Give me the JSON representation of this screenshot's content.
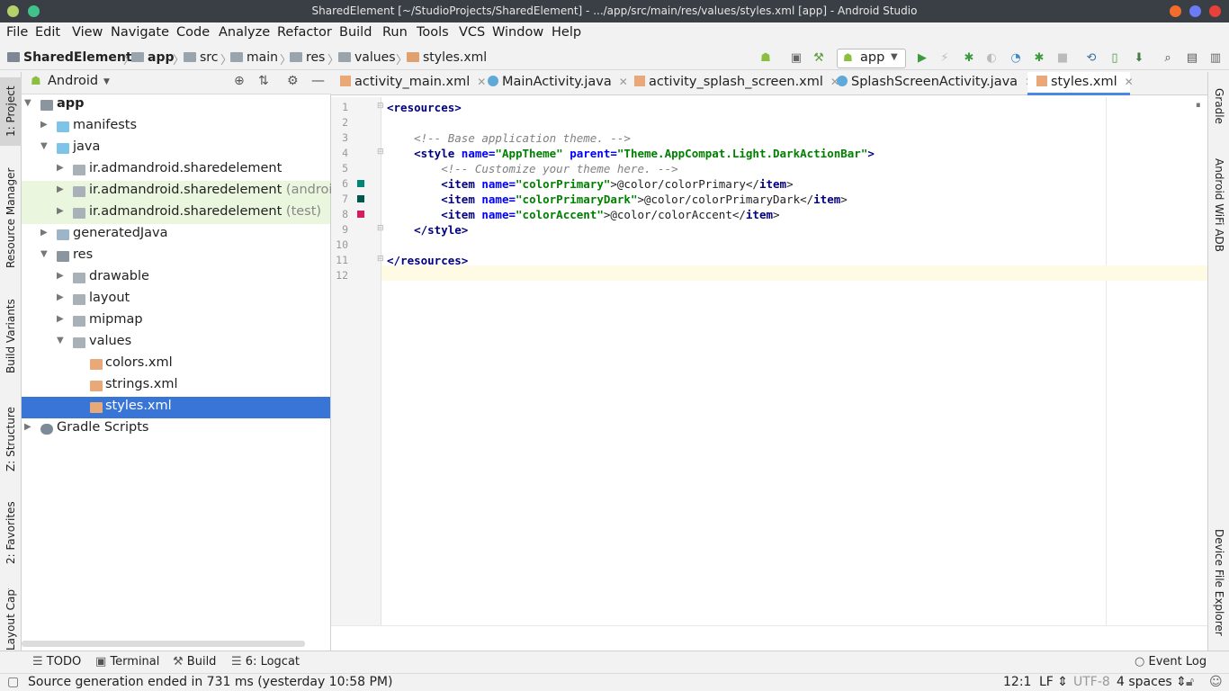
{
  "window": {
    "title": "SharedElement [~/StudioProjects/SharedElement] - .../app/src/main/res/values/styles.xml [app] - Android Studio",
    "controls": [
      "minimize",
      "maximize",
      "close"
    ]
  },
  "menu": [
    "File",
    "Edit",
    "View",
    "Navigate",
    "Code",
    "Analyze",
    "Refactor",
    "Build",
    "Run",
    "Tools",
    "VCS",
    "Window",
    "Help"
  ],
  "breadcrumb": [
    "SharedElement",
    "app",
    "src",
    "main",
    "res",
    "values",
    "styles.xml"
  ],
  "toolbar": {
    "run_config": "app"
  },
  "left_tool_windows": [
    "1: Project",
    "Resource Manager",
    "Build Variants",
    "Z: Structure",
    "2: Favorites",
    "Layout Captures"
  ],
  "right_tool_windows": [
    "Gradle",
    "Android WiFi ADB",
    "Device File Explorer"
  ],
  "project_panel": {
    "view_mode": "Android",
    "tree": [
      {
        "label": "app",
        "bold": true,
        "level": 0
      },
      {
        "label": "manifests",
        "level": 1
      },
      {
        "label": "java",
        "level": 1
      },
      {
        "label": "ir.admandroid.sharedelement",
        "level": 2
      },
      {
        "label": "ir.admandroid.sharedelement",
        "suffix": "(androidTest)",
        "level": 2
      },
      {
        "label": "ir.admandroid.sharedelement",
        "suffix": "(test)",
        "level": 2
      },
      {
        "label": "generatedJava",
        "level": 1
      },
      {
        "label": "res",
        "level": 1
      },
      {
        "label": "drawable",
        "level": 2
      },
      {
        "label": "layout",
        "level": 2
      },
      {
        "label": "mipmap",
        "level": 2
      },
      {
        "label": "values",
        "level": 2
      },
      {
        "label": "colors.xml",
        "level": 3
      },
      {
        "label": "strings.xml",
        "level": 3
      },
      {
        "label": "styles.xml",
        "level": 3,
        "selected": true
      },
      {
        "label": "Gradle Scripts",
        "level": 0
      }
    ]
  },
  "editor_tabs": [
    {
      "label": "activity_main.xml",
      "type": "xml"
    },
    {
      "label": "MainActivity.java",
      "type": "java"
    },
    {
      "label": "activity_splash_screen.xml",
      "type": "xml"
    },
    {
      "label": "SplashScreenActivity.java",
      "type": "java"
    },
    {
      "label": "styles.xml",
      "type": "xml",
      "active": true
    }
  ],
  "code": {
    "line_numbers": [
      "1",
      "2",
      "3",
      "4",
      "5",
      "6",
      "7",
      "8",
      "9",
      "10",
      "11",
      "12"
    ],
    "l1_tag": "<resources>",
    "l3_comment": "<!-- Base application theme. -->",
    "l4": {
      "open": "<style",
      "a1": " name=",
      "v1": "\"AppTheme\"",
      "a2": " parent=",
      "v2": "\"Theme.AppCompat.Light.DarkActionBar\"",
      "close": ">"
    },
    "l5_comment": "<!-- Customize your theme here. -->",
    "l6": {
      "open": "<item",
      "a": " name=",
      "v": "\"colorPrimary\"",
      "text": ">@color/colorPrimary</",
      "tag": "item",
      "close": ">"
    },
    "l7": {
      "open": "<item",
      "a": " name=",
      "v": "\"colorPrimaryDark\"",
      "text": ">@color/colorPrimaryDark</",
      "tag": "item",
      "close": ">"
    },
    "l8": {
      "open": "<item",
      "a": " name=",
      "v": "\"colorAccent\"",
      "text": ">@color/colorAccent</",
      "tag": "item",
      "close": ">"
    },
    "l9_tag": "</style>",
    "l11_tag": "</resources>",
    "gutter_colors": {
      "colorPrimary": "#008577",
      "colorPrimaryDark": "#00574B",
      "colorAccent": "#D81B60"
    }
  },
  "bottom_tools": [
    "TODO",
    "Terminal",
    "Build",
    "6: Logcat"
  ],
  "event_log": "Event Log",
  "status": {
    "message": "Source generation ended in 731 ms (yesterday 10:58 PM)",
    "position": "12:1",
    "line_sep": "LF",
    "encoding": "UTF-8",
    "indent": "4 spaces"
  }
}
